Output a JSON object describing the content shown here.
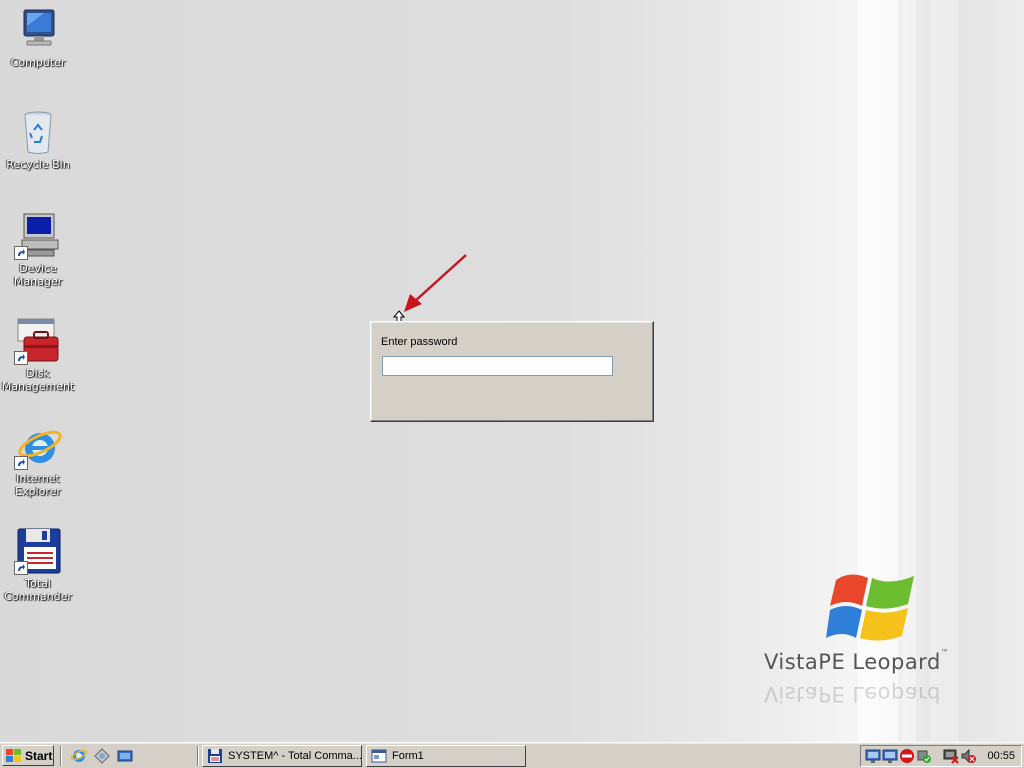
{
  "desktop": {
    "icons": [
      {
        "label": "Computer",
        "icon": "computer-icon"
      },
      {
        "label": "Recycle Bin",
        "icon": "recycle-bin-icon"
      },
      {
        "label": "Device Manager",
        "icon": "device-manager-icon"
      },
      {
        "label": "Disk Management",
        "icon": "disk-management-icon"
      },
      {
        "label": "Internet Explorer",
        "icon": "internet-explorer-icon"
      },
      {
        "label": "Total Commander",
        "icon": "total-commander-icon"
      }
    ],
    "logo": {
      "brand": "VistaPE Leopard",
      "trademark": "™"
    }
  },
  "dialog": {
    "label": "Enter password",
    "password_value": "",
    "annotation_arrow_color": "#c8141e"
  },
  "taskbar": {
    "start_label": "Start",
    "quick_launch": [
      "internet-explorer-icon",
      "windows-explorer-icon",
      "show-desktop-icon"
    ],
    "tasks": [
      {
        "label": "SYSTEM^ - Total Comma...",
        "icon": "floppy-disk-icon"
      },
      {
        "label": "Form1",
        "icon": "window-icon"
      }
    ],
    "tray_icons": [
      "network-icon",
      "network-icon",
      "no-entry-icon",
      "usb-safe-remove-icon",
      "network-disconnected-icon",
      "volume-muted-icon"
    ],
    "clock": "00:55"
  }
}
